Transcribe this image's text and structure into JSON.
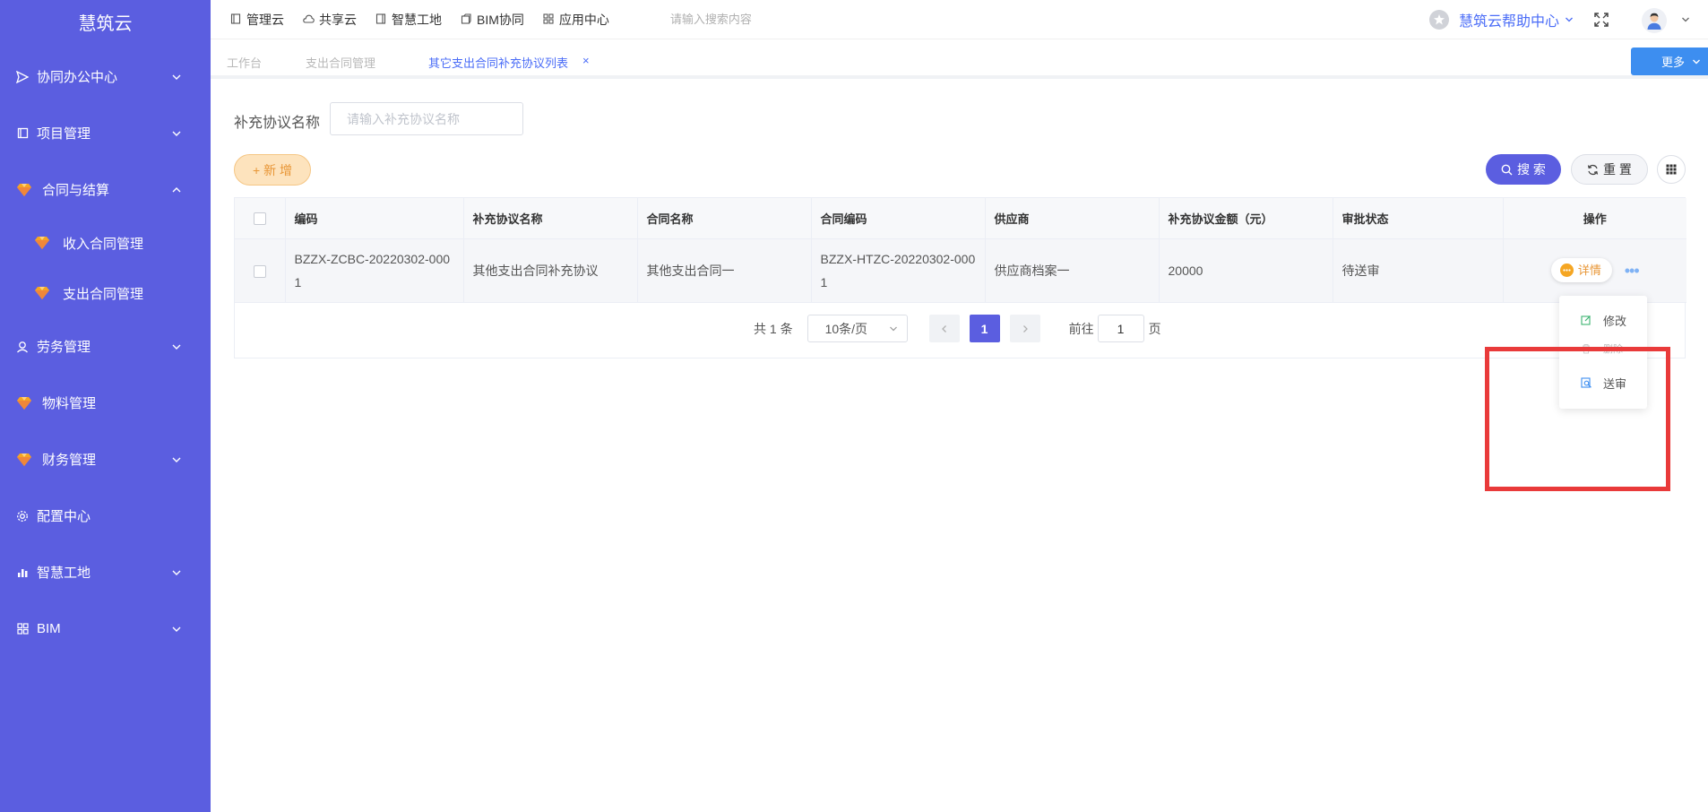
{
  "app": {
    "logo": "慧筑云"
  },
  "sidebar": {
    "items": [
      {
        "label": "协同办公中心",
        "icon": "send-icon"
      },
      {
        "label": "项目管理",
        "icon": "book-icon"
      },
      {
        "label": "合同与结算",
        "icon": "gem-icon"
      },
      {
        "label": "收入合同管理",
        "icon": "gem-icon"
      },
      {
        "label": "支出合同管理",
        "icon": "gem-icon"
      },
      {
        "label": "劳务管理",
        "icon": "worker-icon"
      },
      {
        "label": "物料管理",
        "icon": "gem-icon"
      },
      {
        "label": "财务管理",
        "icon": "gem-icon"
      },
      {
        "label": "配置中心",
        "icon": "gear-icon"
      },
      {
        "label": "智慧工地",
        "icon": "bar-chart-icon"
      },
      {
        "label": "BIM",
        "icon": "grid-icon"
      }
    ]
  },
  "topbar": {
    "links": [
      {
        "label": "管理云"
      },
      {
        "label": "共享云"
      },
      {
        "label": "智慧工地"
      },
      {
        "label": "BIM协同"
      },
      {
        "label": "应用中心"
      }
    ],
    "search_placeholder": "请输入搜索内容",
    "help_label": "慧筑云帮助中心"
  },
  "tabs": {
    "items": [
      {
        "label": "工作台"
      },
      {
        "label": "支出合同管理"
      },
      {
        "label": "其它支出合同补充协议列表"
      }
    ],
    "close": "×",
    "more_label": "更多"
  },
  "filter": {
    "label": "补充协议名称",
    "placeholder": "请输入补充协议名称"
  },
  "buttons": {
    "add": "+ 新 增",
    "search": "搜 索",
    "reset": "重 置"
  },
  "table": {
    "headers": [
      "编码",
      "补充协议名称",
      "合同名称",
      "合同编码",
      "供应商",
      "补充协议金额（元）",
      "审批状态",
      "操作"
    ],
    "rows": [
      {
        "code": "BZZX-ZCBC-20220302-0001",
        "agreement_name": "其他支出合同补充协议",
        "contract_name": "其他支出合同一",
        "contract_code": "BZZX-HTZC-20220302-0001",
        "supplier": "供应商档案一",
        "amount": "20000",
        "status": "待送审",
        "detail_label": "详情",
        "more_label": "•••"
      }
    ]
  },
  "pagination": {
    "total": "共 1 条",
    "page_size": "10条/页",
    "current_page": "1",
    "goto_prefix": "前往",
    "goto_value": "1",
    "goto_suffix": "页"
  },
  "dropdown": {
    "items": [
      {
        "label": "修改",
        "icon": "edit-icon"
      },
      {
        "label": "删除",
        "icon": "delete-icon"
      },
      {
        "label": "送审",
        "icon": "submit-review-icon"
      }
    ]
  },
  "colors": {
    "sidebar_bg": "#5b5ee0",
    "primary": "#5b5ee0",
    "link_blue": "#4a6cf7",
    "more_btn": "#3d8ef0",
    "add_orange": "#e89636",
    "highlight_red": "#e93a3a"
  }
}
